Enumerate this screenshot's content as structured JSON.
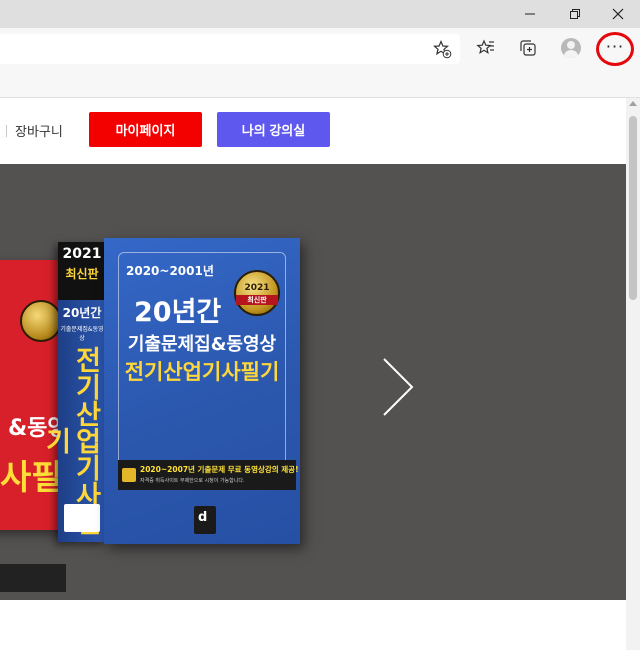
{
  "titlebar": {
    "minimize_icon": "minimize-icon",
    "restore_icon": "restore-icon",
    "close_icon": "close-icon"
  },
  "toolbar": {
    "favorite_add_icon": "star-plus-icon",
    "favorites_icon": "favorites-icon",
    "collections_icon": "collections-icon",
    "profile_icon": "profile-avatar",
    "menu_label": "···",
    "menu_highlight_color": "#e5070c"
  },
  "header": {
    "cart_label": "장바구니",
    "mypage_label": "마이페이지",
    "mylecture_label": "나의 강의실",
    "mypage_color": "#f30000",
    "mylecture_color": "#5f58ef"
  },
  "banner": {
    "background_color": "#545251",
    "next_icon": "chevron-right-icon",
    "book": {
      "spine_year": "2021",
      "spine_edition": "최신판",
      "spine_years": "20년간",
      "spine_subtitle": "기출문제집&동영상",
      "spine_title": "전기산업기사필기",
      "range": "2020~2001년",
      "seal_year": "2021",
      "seal_edition": "최신판",
      "title_main": "20년간",
      "title_sub": "기출문제집&동영상",
      "title_subject": "전기산업기사필기",
      "band_main": "2020~2007년 기출문제 무료 동영상강의 제공!",
      "band_sub": "자격증 취득사이트 무제한으로 시청이 가능합니다."
    },
    "back_book": {
      "title": "&동영상",
      "subject": "사필기"
    }
  }
}
